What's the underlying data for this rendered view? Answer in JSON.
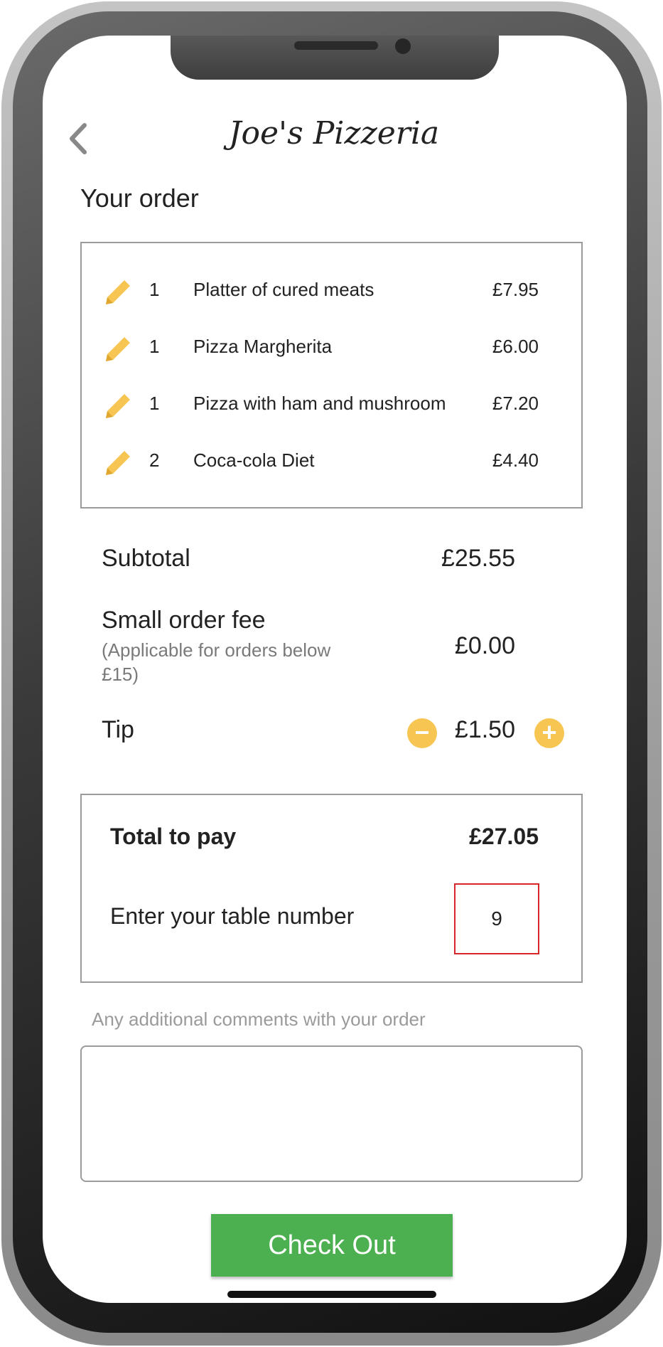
{
  "header": {
    "title": "Joe's Pizzeria",
    "back_icon": "chevron-left-icon"
  },
  "order": {
    "title": "Your order",
    "items": [
      {
        "qty": "1",
        "name": "Platter of cured meats",
        "price": "£7.95"
      },
      {
        "qty": "1",
        "name": "Pizza Margherita",
        "price": "£6.00"
      },
      {
        "qty": "1",
        "name": "Pizza with ham and mushroom",
        "price": "£7.20"
      },
      {
        "qty": "2",
        "name": "Coca-cola Diet",
        "price": "£4.40"
      }
    ],
    "edit_icon": "pencil-icon"
  },
  "summary": {
    "subtotal_label": "Subtotal",
    "subtotal_value": "£25.55",
    "fee_label": "Small order fee",
    "fee_note": "(Applicable for orders below £15)",
    "fee_value": "£0.00",
    "tip_label": "Tip",
    "tip_value": "£1.50",
    "tip_decrease": "−",
    "tip_increase": "+"
  },
  "payment": {
    "total_label": "Total to pay",
    "total_value": "£27.05",
    "table_label": "Enter your table number",
    "table_value": "9"
  },
  "comments": {
    "label": "Any additional comments with your order",
    "value": ""
  },
  "checkout": {
    "label": "Check Out"
  },
  "colors": {
    "accent_yellow": "#f7c552",
    "checkout_green": "#4caf50",
    "table_input_border": "#d9262a"
  }
}
